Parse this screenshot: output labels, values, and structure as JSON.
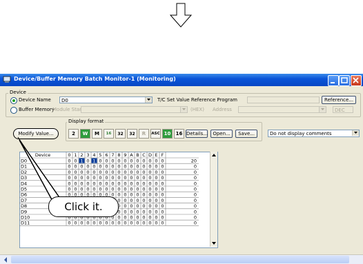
{
  "window": {
    "title": "Device/Buffer Memory Batch Monitor-1 (Monitoring)"
  },
  "device_group": {
    "legend": "Device",
    "device_name_label": "Device Name",
    "device_name_value": "D0",
    "tc_label": "T/C Set Value Reference Program",
    "reference_button": "Reference...",
    "buffer_memory_label": "Buffer Memory",
    "module_start_label": "Module Start",
    "hex_label": "(HEX)",
    "address_label": "Address",
    "dec_value": "DEC"
  },
  "toolbar": {
    "display_format_legend": "Display format",
    "modify_value_button": "Modify Value...",
    "format_buttons": [
      "2",
      "W",
      "M",
      "16",
      "32",
      "32",
      "R",
      "ASC",
      "10",
      "16"
    ],
    "details_button": "Details...",
    "open_button": "Open...",
    "save_button": "Save...",
    "comment_select": "Do not display comments"
  },
  "table": {
    "header_device": "Device",
    "bit_headers": [
      "0",
      "1",
      "2",
      "3",
      "4",
      "5",
      "6",
      "7",
      "8",
      "9",
      "A",
      "B",
      "C",
      "D",
      "E",
      "F"
    ],
    "rows": [
      {
        "device": "D0",
        "bits": [
          "0",
          "0",
          "1",
          "0",
          "1",
          "0",
          "0",
          "0",
          "0",
          "0",
          "0",
          "0",
          "0",
          "0",
          "0",
          "0"
        ],
        "value": "20",
        "highlight": [
          2,
          4
        ]
      },
      {
        "device": "D1",
        "bits": [
          "0",
          "0",
          "0",
          "0",
          "0",
          "0",
          "0",
          "0",
          "0",
          "0",
          "0",
          "0",
          "0",
          "0",
          "0",
          "0"
        ],
        "value": "0",
        "highlight": []
      },
      {
        "device": "D2",
        "bits": [
          "0",
          "0",
          "0",
          "0",
          "0",
          "0",
          "0",
          "0",
          "0",
          "0",
          "0",
          "0",
          "0",
          "0",
          "0",
          "0"
        ],
        "value": "0",
        "highlight": []
      },
      {
        "device": "D3",
        "bits": [
          "0",
          "0",
          "0",
          "0",
          "0",
          "0",
          "0",
          "0",
          "0",
          "0",
          "0",
          "0",
          "0",
          "0",
          "0",
          "0"
        ],
        "value": "0",
        "highlight": []
      },
      {
        "device": "D4",
        "bits": [
          "0",
          "0",
          "0",
          "0",
          "0",
          "0",
          "0",
          "0",
          "0",
          "0",
          "0",
          "0",
          "0",
          "0",
          "0",
          "0"
        ],
        "value": "0",
        "highlight": []
      },
      {
        "device": "D5",
        "bits": [
          "0",
          "0",
          "0",
          "0",
          "0",
          "0",
          "0",
          "0",
          "0",
          "0",
          "0",
          "0",
          "0",
          "0",
          "0",
          "0"
        ],
        "value": "0",
        "highlight": []
      },
      {
        "device": "D6",
        "bits": [
          "0",
          "0",
          "0",
          "0",
          "0",
          "0",
          "0",
          "0",
          "0",
          "0",
          "0",
          "0",
          "0",
          "0",
          "0",
          "0"
        ],
        "value": "0",
        "highlight": []
      },
      {
        "device": "D7",
        "bits": [
          "0",
          "0",
          "0",
          "0",
          "0",
          "0",
          "0",
          "0",
          "0",
          "0",
          "0",
          "0",
          "0",
          "0",
          "0",
          "0"
        ],
        "value": "0",
        "highlight": []
      },
      {
        "device": "D8",
        "bits": [
          "0",
          "0",
          "0",
          "0",
          "0",
          "0",
          "0",
          "0",
          "0",
          "0",
          "0",
          "0",
          "0",
          "0",
          "0",
          "0"
        ],
        "value": "0",
        "highlight": []
      },
      {
        "device": "D9",
        "bits": [
          "0",
          "0",
          "0",
          "0",
          "0",
          "0",
          "0",
          "0",
          "0",
          "0",
          "0",
          "0",
          "0",
          "0",
          "0",
          "0"
        ],
        "value": "0",
        "highlight": []
      },
      {
        "device": "D10",
        "bits": [
          "0",
          "0",
          "0",
          "0",
          "0",
          "0",
          "0",
          "0",
          "0",
          "0",
          "0",
          "0",
          "0",
          "0",
          "0",
          "0"
        ],
        "value": "0",
        "highlight": []
      },
      {
        "device": "D11",
        "bits": [
          "0",
          "0",
          "0",
          "0",
          "0",
          "0",
          "0",
          "0",
          "0",
          "0",
          "0",
          "0",
          "0",
          "0",
          "0",
          "0"
        ],
        "value": "0",
        "highlight": []
      }
    ]
  },
  "callout": {
    "text": "Click it."
  },
  "colors": {
    "titlebar": "#0a55d8",
    "highlight": "#0a3f9c",
    "window_bg": "#ece9d8"
  }
}
